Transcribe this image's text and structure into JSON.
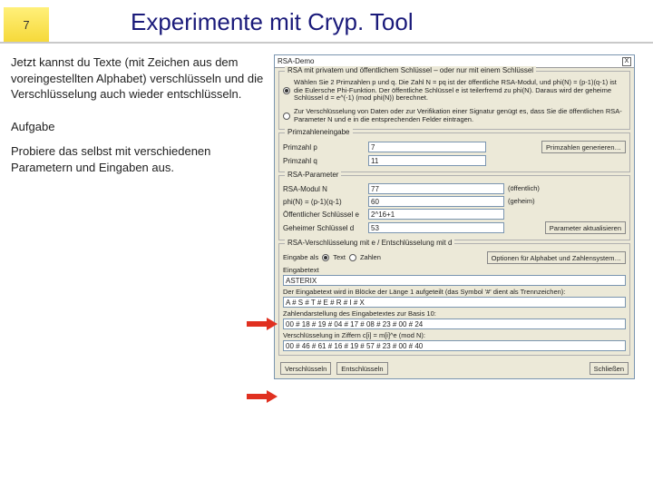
{
  "header": {
    "pagenum": "7",
    "title": "Experimente mit Cryp. Tool"
  },
  "left": {
    "p1": "Jetzt kannst du Texte (mit Zeichen aus dem voreingestellten Alphabet) verschlüsseln und die Verschlüsselung auch wieder entschlüsseln.",
    "task_heading": "Aufgabe",
    "p2": "Probiere das selbst mit verschiedenen Parametern und Eingaben aus."
  },
  "dlg": {
    "title": "RSA-Demo",
    "close": "X",
    "group_keys": {
      "legend": "RSA mit privatem und öffentlichem Schlüssel – oder nur mit einem Schlüssel",
      "opt1": "Wählen Sie 2 Primzahlen p und q. Die Zahl N = pq ist der öffentliche RSA-Modul, und phi(N) = (p-1)(q-1) ist die Eulersche Phi-Funktion. Der öffentliche Schlüssel e ist teilerfremd zu phi(N). Daraus wird der geheime Schlüssel d = e^(-1) (mod phi(N)) berechnet.",
      "opt2": "Zur Verschlüsselung von Daten oder zur Verifikation einer Signatur genügt es, dass Sie die öffentlichen RSA-Parameter N und e in die entsprechenden Felder eintragen."
    },
    "group_primes": {
      "legend": "Primzahleneingabe",
      "p_label": "Primzahl p",
      "p_val": "7",
      "q_label": "Primzahl q",
      "q_val": "11",
      "gen_btn": "Primzahlen generieren…"
    },
    "group_params": {
      "legend": "RSA-Parameter",
      "N_label": "RSA-Modul N",
      "N_val": "77",
      "N_note": "(öffentlich)",
      "phi_label": "phi(N) = (p-1)(q-1)",
      "phi_val": "60",
      "phi_note": "(geheim)",
      "e_label": "Öffentlicher Schlüssel e",
      "e_val": "2^16+1",
      "d_label": "Geheimer Schlüssel d",
      "d_val": "53",
      "update_btn": "Parameter aktualisieren"
    },
    "group_crypt": {
      "legend": "RSA-Verschlüsselung mit e / Entschlüsselung mit d",
      "input_as": "Eingabe als",
      "opt_text": "Text",
      "opt_num": "Zahlen",
      "alphabet_btn": "Optionen für Alphabet und Zahlensystem…",
      "inputtext_label": "Eingabetext",
      "inputtext_val": "ASTERIX",
      "blocks_label": "Der Eingabetext wird in Blöcke der Länge 1 aufgeteilt (das Symbol '#' dient als Trennzeichen):",
      "blocks_val": "A # S # T # E # R # I # X",
      "base_label": "Zahlendarstellung des Eingabetextes zur Basis 10:",
      "base_val": "00 # 18 # 19 # 04 # 17 # 08 # 23 # 00 # 24",
      "cipher_label": "Verschlüsselung in Ziffern c[i] = m[i]^e (mod N):",
      "cipher_val": "00 # 46 # 61 # 16 # 19 # 57 # 23 # 00 # 40"
    },
    "buttons": {
      "encrypt": "Verschlüsseln",
      "decrypt": "Entschlüsseln",
      "close": "Schließen"
    }
  }
}
